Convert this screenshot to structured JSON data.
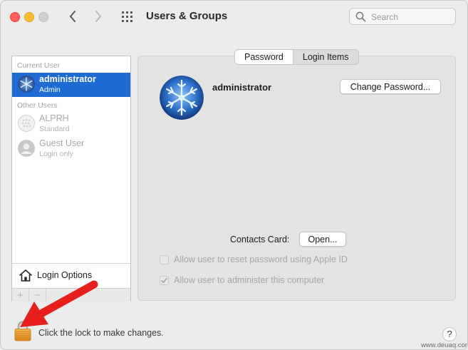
{
  "window": {
    "title": "Users & Groups",
    "search_placeholder": "Search"
  },
  "sidebar": {
    "current_user_header": "Current User",
    "other_users_header": "Other Users",
    "users": [
      {
        "name": "administrator",
        "role": "Admin",
        "selected": true
      },
      {
        "name": "ALPRH",
        "role": "Standard",
        "selected": false
      },
      {
        "name": "Guest User",
        "role": "Login only",
        "selected": false
      }
    ],
    "login_options_label": "Login Options",
    "add_label": "+",
    "remove_label": "−"
  },
  "main": {
    "tabs": [
      {
        "label": "Password",
        "active": true
      },
      {
        "label": "Login Items",
        "active": false
      }
    ],
    "user_name": "administrator",
    "change_password_label": "Change Password...",
    "contacts_card_label": "Contacts Card:",
    "open_label": "Open...",
    "checkboxes": [
      {
        "label": "Allow user to reset password using Apple ID",
        "checked": false
      },
      {
        "label": "Allow user to administer this computer",
        "checked": true
      }
    ]
  },
  "footer": {
    "lock_text": "Click the lock to make changes.",
    "help_label": "?"
  },
  "watermark": "www.deuaq.com",
  "colors": {
    "selection": "#1f6bd4",
    "arrow": "#e8201d",
    "lock": "#e39b2b"
  },
  "icons": [
    "back-chevron-icon",
    "forward-chevron-icon",
    "grid-icon",
    "search-icon",
    "house-icon",
    "lock-icon",
    "help-icon",
    "snowflake-avatar-icon",
    "generic-user-icon"
  ]
}
